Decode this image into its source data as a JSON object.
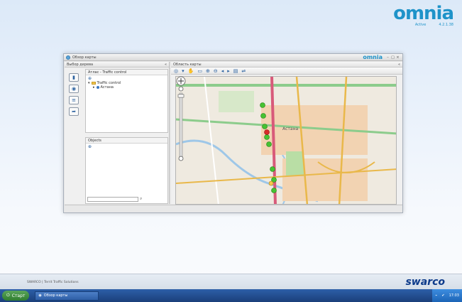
{
  "brand": {
    "logo": "omnia",
    "sub_left": "Active",
    "sub_right": "4.2.1.38"
  },
  "window": {
    "title": "Обзор карты",
    "logo": "omnia",
    "left_panel": {
      "header": "Выбор дерева",
      "tree_title": "Атлас - Traffic control",
      "tree_nodes": [
        "Traffic control",
        "Астана"
      ],
      "objects_header": "Objects",
      "search_placeholder": ""
    },
    "right_panel": {
      "header": "Область карты",
      "city_label": "Астана"
    }
  },
  "footer": {
    "text": "SWARCO | Territ Traffic Solutions",
    "logo": "swarco"
  },
  "taskbar": {
    "start_label": "Старт",
    "task_label": "Обзор карты",
    "time": "17:03"
  }
}
